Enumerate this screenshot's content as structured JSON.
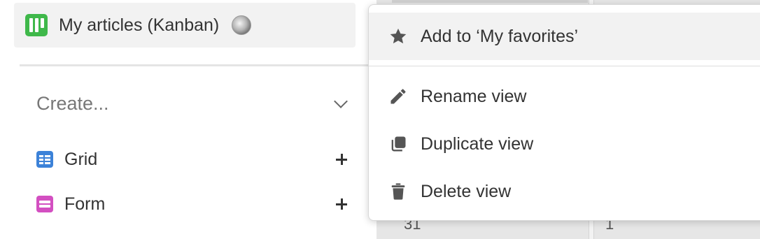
{
  "current_view": {
    "title": "My articles (Kanban)",
    "icon": "kanban-icon",
    "icon_color": "#3fb84a"
  },
  "create_section": {
    "label": "Create...",
    "items": [
      {
        "label": "Grid",
        "icon": "grid-icon",
        "color": "#3c82d8"
      },
      {
        "label": "Form",
        "icon": "form-icon",
        "color": "#d34fc1"
      }
    ]
  },
  "context_menu": {
    "items": [
      {
        "label": "Add to ‘My favorites’",
        "icon": "star-icon"
      },
      {
        "label": "Rename view",
        "icon": "pencil-icon"
      },
      {
        "label": "Duplicate view",
        "icon": "duplicate-icon"
      },
      {
        "label": "Delete view",
        "icon": "trash-icon"
      }
    ]
  },
  "background_cells": [
    "31",
    "1"
  ]
}
